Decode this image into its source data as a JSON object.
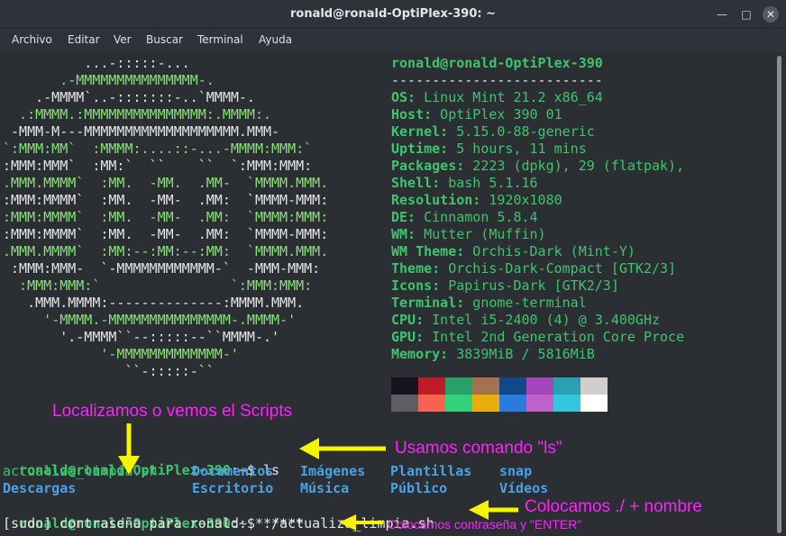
{
  "window": {
    "title": "ronald@ronald-OptiPlex-390: ~"
  },
  "menu": [
    "Archivo",
    "Editar",
    "Ver",
    "Buscar",
    "Terminal",
    "Ayuda"
  ],
  "logo_lines": [
    "          ...-:::::-...",
    "       .-MMMMMMMMMMMMMMM-.",
    "    .-MMMM`..-:::::::-..`MMMM-.",
    "  .:MMMM.:MMMMMMMMMMMMMMM:.MMMM:.",
    " -MMM-M---MMMMMMMMMMMMMMMMMMM.MMM-",
    "`:MMM:MM`  :MMMM:....::-...-MMMM:MMM:`",
    ":MMM:MMM`  :MM:`  ``    ``  `:MMM:MMM:",
    ".MMM.MMMM`  :MM.  -MM.  .MM-  `MMMM.MMM.",
    ":MMM:MMMM`  :MM.  -MM-  .MM:  `MMMM-MMM:",
    ":MMM:MMMM`  :MM.  -MM-  .MM:  `MMMM:MMM:",
    ":MMM:MMMM`  :MM.  -MM-  .MM:  `MMMM-MMM:",
    ".MMM.MMMM`  :MM:--:MM:--:MM:  `MMMM.MMM.",
    " :MMM:MMM-  `-MMMMMMMMMMMM-`  -MMM-MMM:",
    "  :MMM:MMM:`                `:MMM:MMM:",
    "   .MMM.MMMM:--------------:MMMM.MMM.",
    "     '-MMMM.-MMMMMMMMMMMMMMM-.MMMM-'",
    "       '.-MMMM``--:::::--``MMMM-.'",
    "            '-MMMMMMMMMMMMM-'",
    "               ``-:::::-``"
  ],
  "neofetch": {
    "header": "ronald@ronald-OptiPlex-390",
    "separator": "--------------------------",
    "fields": [
      {
        "key": "OS",
        "value": "Linux Mint 21.2 x86_64"
      },
      {
        "key": "Host",
        "value": "OptiPlex 390 01"
      },
      {
        "key": "Kernel",
        "value": "5.15.0-88-generic"
      },
      {
        "key": "Uptime",
        "value": "5 hours, 11 mins"
      },
      {
        "key": "Packages",
        "value": "2223 (dpkg), 29 (flatpak),"
      },
      {
        "key": "Shell",
        "value": "bash 5.1.16"
      },
      {
        "key": "Resolution",
        "value": "1920x1080"
      },
      {
        "key": "DE",
        "value": "Cinnamon 5.8.4"
      },
      {
        "key": "WM",
        "value": "Mutter (Muffin)"
      },
      {
        "key": "WM Theme",
        "value": "Orchis-Dark (Mint-Y)"
      },
      {
        "key": "Theme",
        "value": "Orchis-Dark-Compact [GTK2/3]"
      },
      {
        "key": "Icons",
        "value": "Papirus-Dark [GTK2/3]"
      },
      {
        "key": "Terminal",
        "value": "gnome-terminal"
      },
      {
        "key": "CPU",
        "value": "Intel i5-2400 (4) @ 3.400GHz"
      },
      {
        "key": "GPU",
        "value": "Intel 2nd Generation Core Proce"
      },
      {
        "key": "Memory",
        "value": "3839MiB / 5816MiB"
      }
    ],
    "palette_row1": [
      "#171421",
      "#c01c28",
      "#26a269",
      "#a2734c",
      "#12488b",
      "#a347ba",
      "#2aa1b3",
      "#d0cfcc"
    ],
    "palette_row2": [
      "#5e5c64",
      "#f66151",
      "#33d17a",
      "#e9ad0c",
      "#2a7bde",
      "#c061cb",
      "#33c7de",
      "#ffffff"
    ]
  },
  "prompt": {
    "user_host": "ronald@ronald-OptiPlex-390",
    "path_suffix": ":~$ ",
    "cmd1": "ls",
    "cmd2": "./actualiza_limpia.sh"
  },
  "ls_output": {
    "row1": [
      "actualiza_limpia.sh",
      "Documentos",
      "Imágenes",
      "Plantillas",
      "snap"
    ],
    "row2": [
      "Descargas",
      "Escritorio",
      "Música",
      "Público",
      "Vídeos"
    ]
  },
  "sudo_line": "[sudo] contraseña para ronald: ******",
  "annotations": {
    "scripts": "Localizamos o vemos el Scripts",
    "ls": "Usamos comando \"ls\"",
    "run": "Colocamos ./ + nombre",
    "password": "Colocamos contraseña y \"ENTER\""
  },
  "colors": {
    "annotation": "#ff22ff",
    "arrow": "#f5f500",
    "green": "#3fc56d",
    "blue": "#4aa3e6"
  }
}
